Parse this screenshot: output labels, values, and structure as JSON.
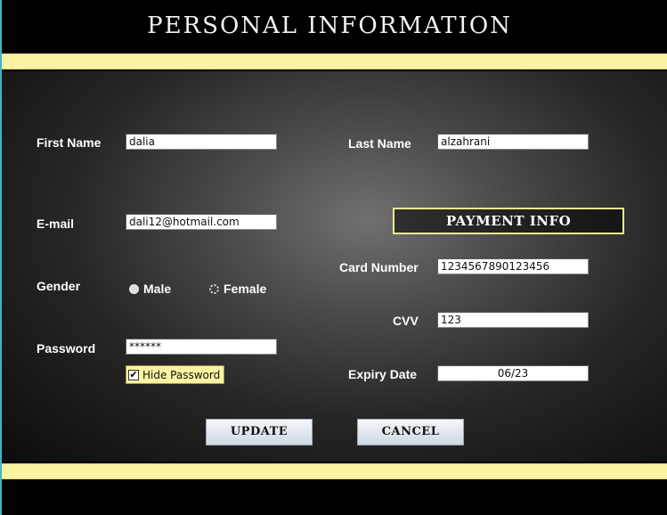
{
  "window": {
    "title": "PERSONAL INFORMATION"
  },
  "form": {
    "first_name": {
      "label": "First Name",
      "value": "dalia"
    },
    "last_name": {
      "label": "Last Name",
      "value": "alzahrani"
    },
    "email": {
      "label": "E-mail",
      "value": "dali12@hotmail.com"
    },
    "gender": {
      "label": "Gender",
      "options": [
        "Male",
        "Female"
      ],
      "selected": "Male"
    },
    "password": {
      "label": "Password",
      "value": "******"
    },
    "hide_password": {
      "label": "Hide Password",
      "checked": true
    }
  },
  "payment": {
    "heading": "PAYMENT INFO",
    "card_number": {
      "label": "Card Number",
      "value": "1234567890123456"
    },
    "cvv": {
      "label": "CVV",
      "value": "123"
    },
    "expiry": {
      "label": "Expiry Date",
      "value": "06/23"
    }
  },
  "buttons": {
    "update": "UPDATE",
    "cancel": "CANCEL"
  },
  "colors": {
    "stripe": "#fbf3a2",
    "accent_border": "#f3ea8f",
    "background": "#000000"
  }
}
